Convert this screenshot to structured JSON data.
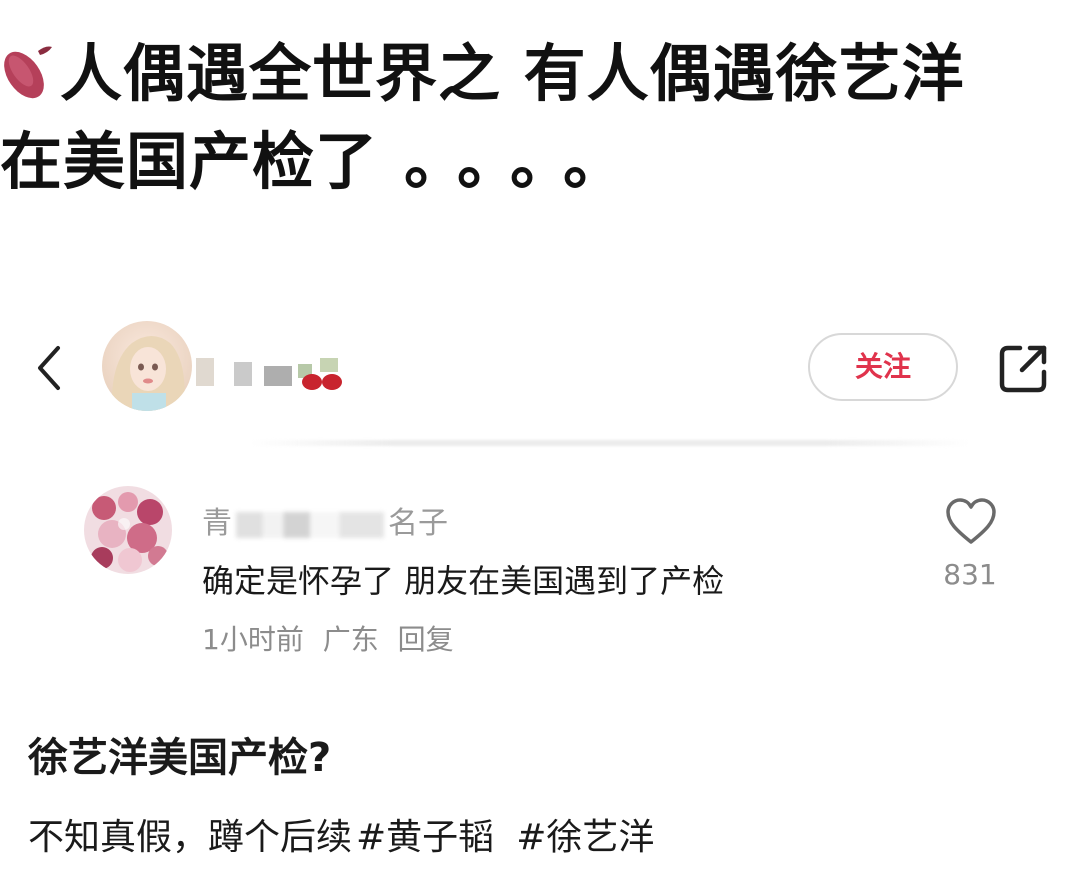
{
  "headline": {
    "line1": "人偶遇全世界之 有人偶遇徐艺洋",
    "line2": "在美国产检了",
    "dots": "。。。。",
    "emoji_icon": "sweet-potato-icon"
  },
  "profile_bar": {
    "back_icon": "chevron-left-icon",
    "follow_label": "关注",
    "share_icon": "share-icon",
    "accent_color": "#e0334c"
  },
  "comment": {
    "username_start": "青",
    "username_end": "名子",
    "text": "确定是怀孕了 朋友在美国遇到了产检",
    "time": "1小时前",
    "location": "广东",
    "reply_label": "回复",
    "like_count": "831"
  },
  "post": {
    "title": "徐艺洋美国产检?",
    "body_text": "不知真假，蹲个后续",
    "hashtags": [
      "#黄子韬",
      "#徐艺洋"
    ]
  }
}
